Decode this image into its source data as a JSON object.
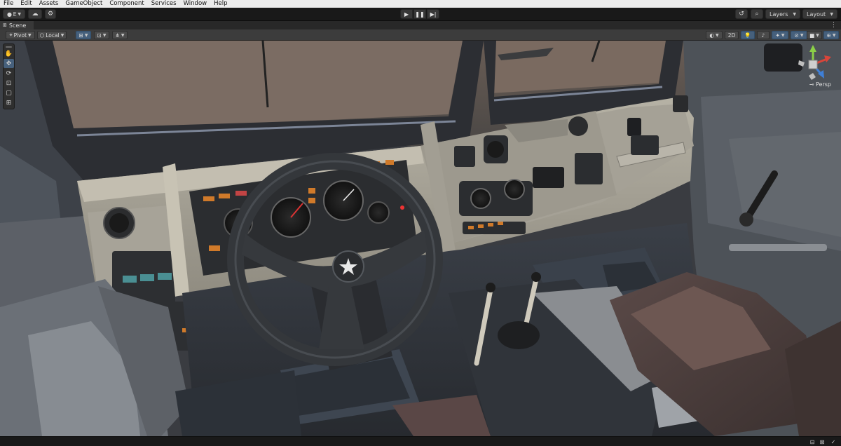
{
  "menu": [
    "File",
    "Edit",
    "Assets",
    "GameObject",
    "Component",
    "Services",
    "Window",
    "Help"
  ],
  "toolbar": {
    "account_label": "E",
    "play_icon": "play-icon",
    "pause_icon": "pause-icon",
    "step_icon": "step-icon",
    "layers_label": "Layers",
    "layout_label": "Layout"
  },
  "scene_tab": {
    "label": "Scene"
  },
  "scene_toolbar": {
    "pivot_label": "Pivot",
    "local_label": "Local",
    "mode_2d_label": "2D"
  },
  "tools": [
    "hand-tool",
    "move-tool",
    "rotate-tool",
    "scale-tool",
    "rect-tool",
    "transform-tool"
  ],
  "active_tool": "move-tool",
  "gizmo": {
    "projection_label": "Persp"
  },
  "colors": {
    "accent_blue": "#46607c",
    "gizmo_x": "#d8453a",
    "gizmo_y": "#8bd047",
    "gizmo_z": "#3f7fd6"
  }
}
